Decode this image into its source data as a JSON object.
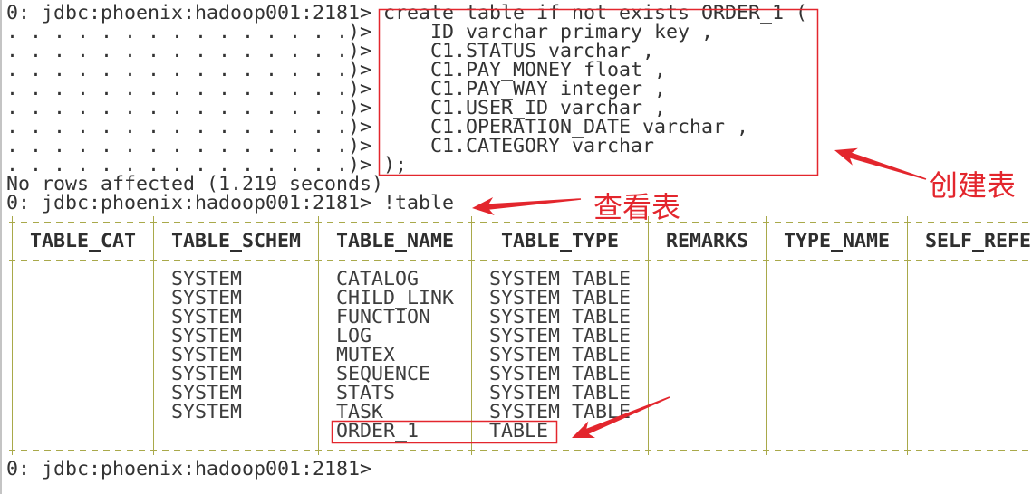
{
  "session": {
    "lines": [
      {
        "prompt": "0: jdbc:phoenix:hadoop001:2181>",
        "text": "create table if not exists ORDER_1 ("
      },
      {
        "prompt": ". . . . . . . . . . . . . . .)>",
        "text": "ID varchar primary key ,"
      },
      {
        "prompt": ". . . . . . . . . . . . . . .)>",
        "text": "C1.STATUS varchar ,"
      },
      {
        "prompt": ". . . . . . . . . . . . . . .)>",
        "text": "C1.PAY_MONEY float ,"
      },
      {
        "prompt": ". . . . . . . . . . . . . . .)>",
        "text": "C1.PAY_WAY integer ,"
      },
      {
        "prompt": ". . . . . . . . . . . . . . .)>",
        "text": "C1.USER_ID varchar ,"
      },
      {
        "prompt": ". . . . . . . . . . . . . . .)>",
        "text": "C1.OPERATION_DATE varchar ,"
      },
      {
        "prompt": ". . . . . . . . . . . . . . .)>",
        "text": "C1.CATEGORY varchar"
      },
      {
        "prompt": ". . . . . . . . . . . . . . .)>",
        "text": ");"
      }
    ],
    "result": "No rows affected (1.219 seconds)",
    "table_command": {
      "prompt": "0: jdbc:phoenix:hadoop001:2181>",
      "text": "!table"
    },
    "table": {
      "columns": [
        "TABLE_CAT",
        "TABLE_SCHEM",
        "TABLE_NAME",
        "TABLE_TYPE",
        "REMARKS",
        "TYPE_NAME",
        "SELF_REFE"
      ],
      "rows": [
        [
          "",
          "SYSTEM",
          "CATALOG",
          "SYSTEM TABLE",
          "",
          "",
          ""
        ],
        [
          "",
          "SYSTEM",
          "CHILD_LINK",
          "SYSTEM TABLE",
          "",
          "",
          ""
        ],
        [
          "",
          "SYSTEM",
          "FUNCTION",
          "SYSTEM TABLE",
          "",
          "",
          ""
        ],
        [
          "",
          "SYSTEM",
          "LOG",
          "SYSTEM TABLE",
          "",
          "",
          ""
        ],
        [
          "",
          "SYSTEM",
          "MUTEX",
          "SYSTEM TABLE",
          "",
          "",
          ""
        ],
        [
          "",
          "SYSTEM",
          "SEQUENCE",
          "SYSTEM TABLE",
          "",
          "",
          ""
        ],
        [
          "",
          "SYSTEM",
          "STATS",
          "SYSTEM TABLE",
          "",
          "",
          ""
        ],
        [
          "",
          "SYSTEM",
          "TASK",
          "SYSTEM TABLE",
          "",
          "",
          ""
        ],
        [
          "",
          "",
          "ORDER_1",
          "TABLE",
          "",
          "",
          ""
        ]
      ]
    },
    "final_prompt": "0: jdbc:phoenix:hadoop001:2181>"
  },
  "annotations": {
    "create_table": "创建表",
    "view_tables": "查看表"
  },
  "colors": {
    "annotation_red": "#e3262d",
    "table_border": "#a9a94a",
    "text": "#333333",
    "background": "#ffffff"
  }
}
